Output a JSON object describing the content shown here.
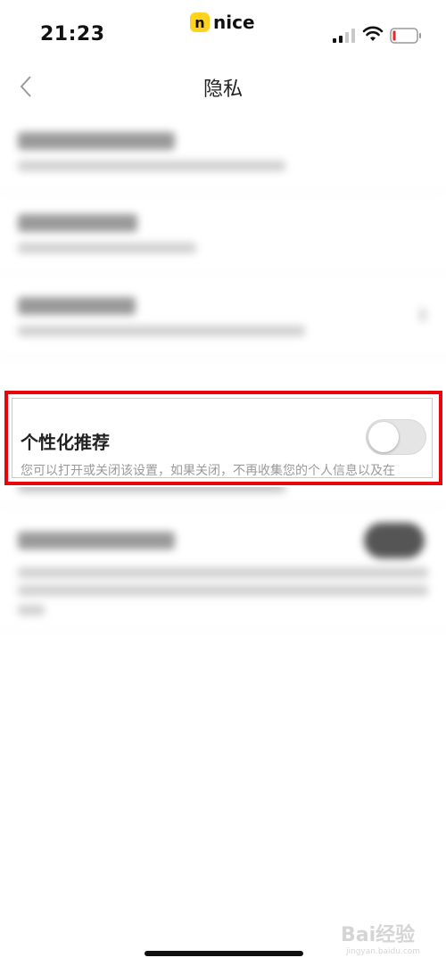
{
  "status_bar": {
    "time": "21:23",
    "brand_badge": "n",
    "brand_text": "nice"
  },
  "nav": {
    "title": "隐私"
  },
  "setting": {
    "title": "个性化推荐",
    "description": "您可以打开或关闭该设置，如果关闭，不再收集您的个人信息以及在",
    "toggle_on": false
  },
  "watermark": {
    "text": "Bai经验",
    "sub": "jingyan.baidu.com"
  },
  "colors": {
    "highlight": "#e8060b",
    "brand": "#ffd21e",
    "toggle_off": "#e5e5e5"
  }
}
